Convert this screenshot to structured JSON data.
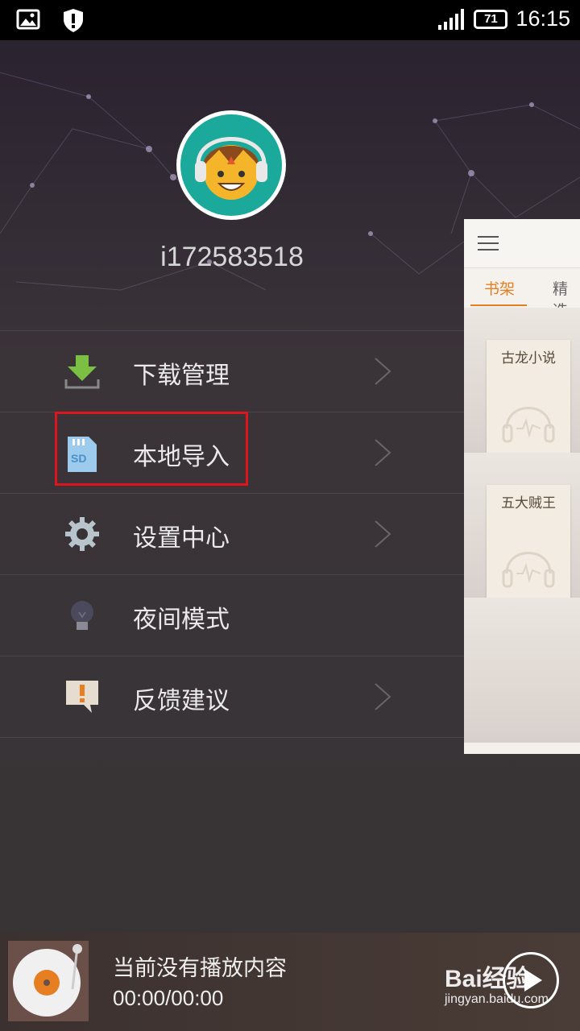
{
  "status_bar": {
    "time": "16:15",
    "battery": "71"
  },
  "profile": {
    "username": "i172583518"
  },
  "menu": [
    {
      "label": "下载管理"
    },
    {
      "label": "本地导入"
    },
    {
      "label": "设置中心"
    },
    {
      "label": "夜间模式"
    },
    {
      "label": "反馈建议"
    }
  ],
  "preview": {
    "tabs": [
      "书架",
      "精选"
    ],
    "books": [
      "古龙小说",
      "五大贼王"
    ]
  },
  "player": {
    "status": "当前没有播放内容",
    "time": "00:00/00:00"
  },
  "watermark": {
    "logo": "Bai经验",
    "url": "jingyan.baidu.com"
  },
  "colors": {
    "accent": "#e67e22",
    "highlight": "#e0141c",
    "avatar_bg": "#1aa99a"
  }
}
